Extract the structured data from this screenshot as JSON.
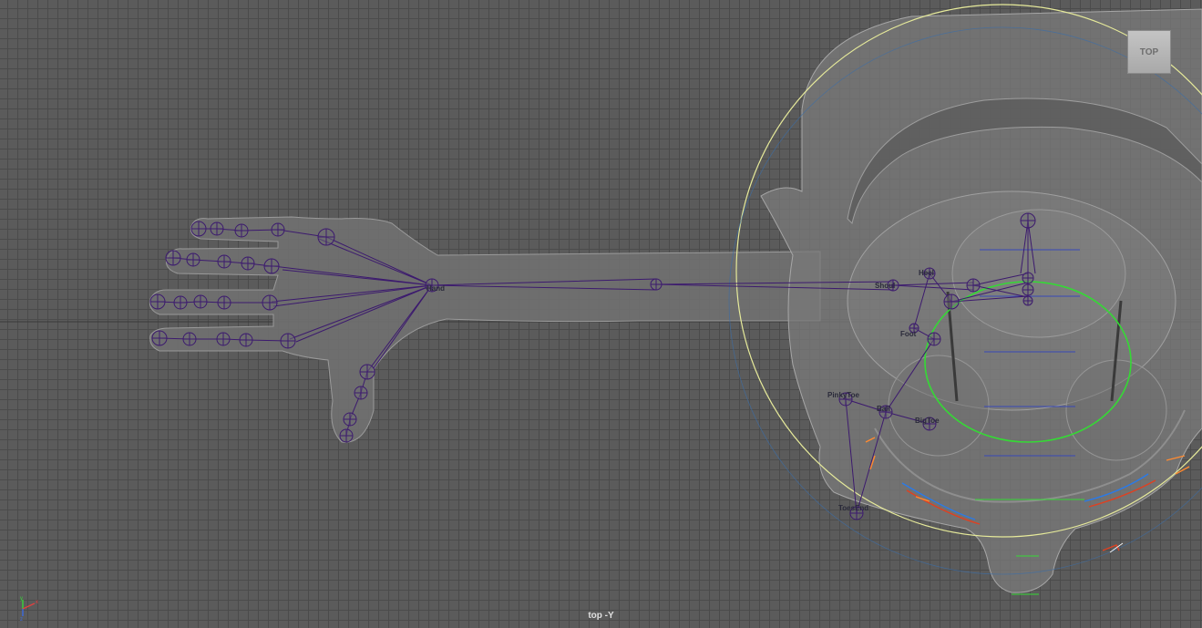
{
  "viewport": {
    "camera_label": "top -Y",
    "view_cube_label": "TOP"
  },
  "joints": {
    "hand": "Hand",
    "shoulder": "Shoul",
    "heel": "Heel",
    "pinky_toe": "PinkyToe",
    "big_toe": "BigToe",
    "toes_end": "ToesEnd",
    "foot": "Foot",
    "ball": "Ball"
  },
  "axis": {
    "x": "x",
    "y": "y",
    "z": "z"
  },
  "colors": {
    "grid_bg": "#5b5b5b",
    "grid_line": "#4b4b4b",
    "joint": "#3c1a6e",
    "selection_circle": "#e6ea9a",
    "control_ring": "#35d935",
    "blue_guide": "#3848b8"
  }
}
